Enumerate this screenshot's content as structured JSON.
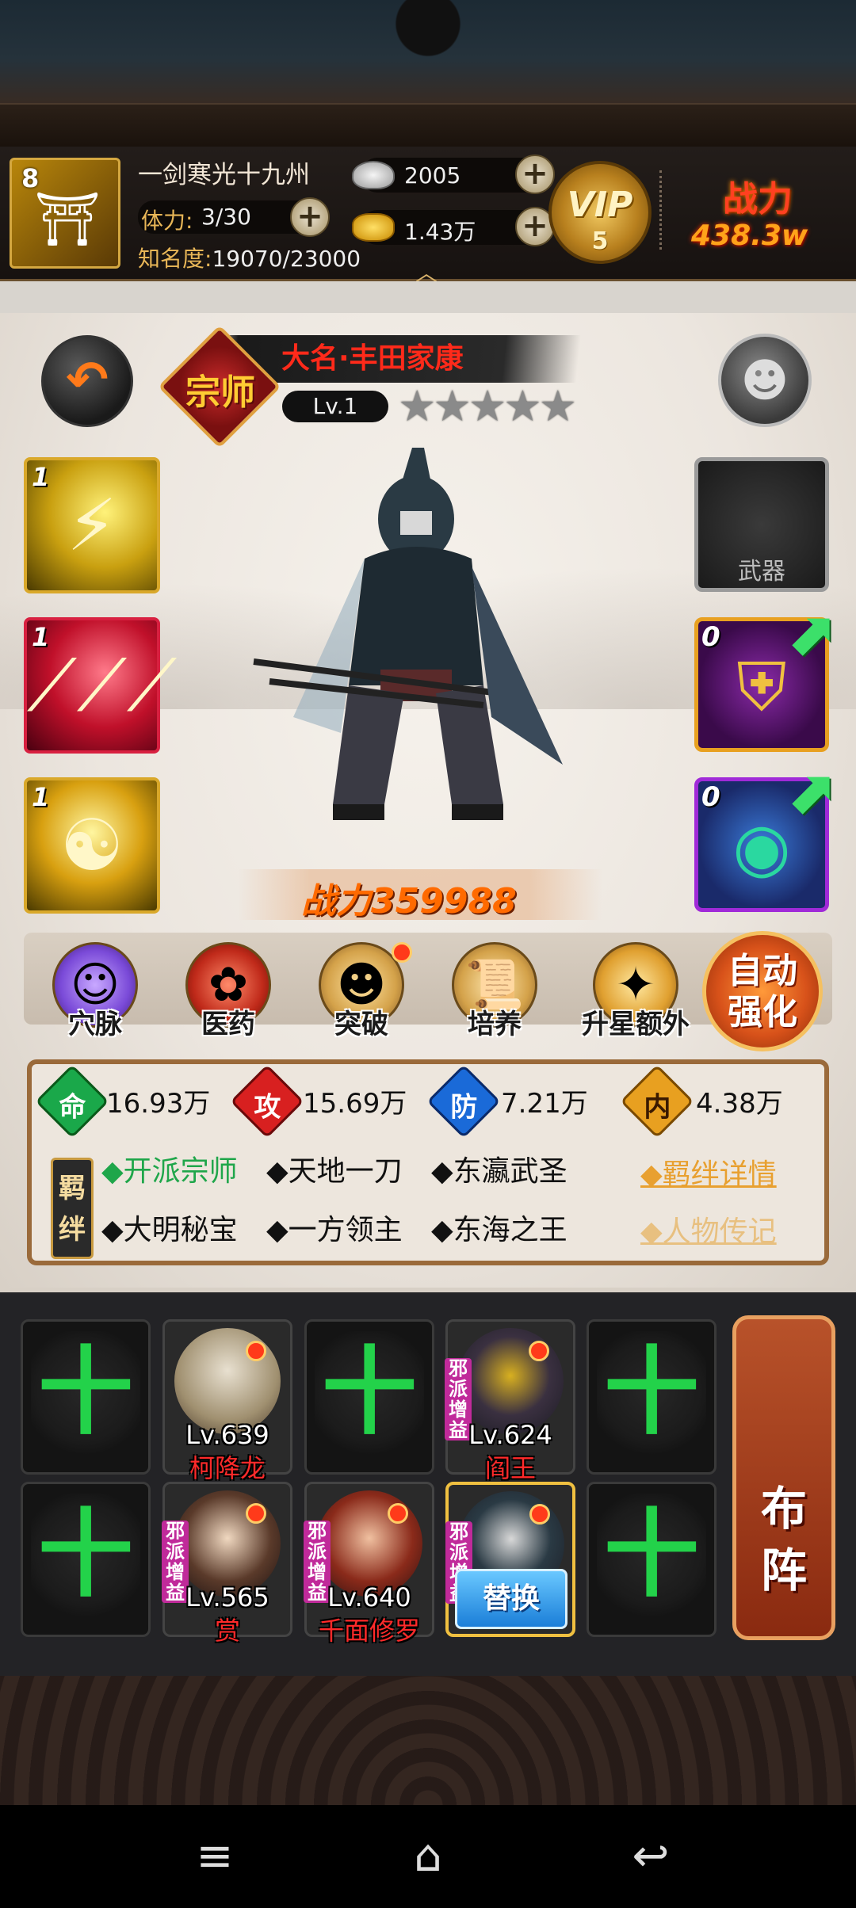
{
  "player": {
    "level": "8",
    "name": "一剑寒光十九州",
    "stamina_label": "体力:",
    "stamina_value": "3/30",
    "fame_label": "知名度:",
    "fame_value": "19070/23000",
    "silver": "2005",
    "gold": "1.43万",
    "vip_label": "VIP",
    "vip_level": "5",
    "power_label": "战力",
    "power_value": "438.3w"
  },
  "hero": {
    "rank": "宗师",
    "title": "大名·丰田家康",
    "level": "Lv.1",
    "stars": "★★★★★",
    "star_count": 0,
    "power": "战力359988"
  },
  "skills": [
    {
      "level": "1",
      "icon": "lightning-skill-icon",
      "color": "#c9a010"
    },
    {
      "level": "1",
      "icon": "claw-skill-icon",
      "color": "#c0102a"
    },
    {
      "level": "1",
      "icon": "fusion-skill-icon",
      "color": "#d8a010"
    }
  ],
  "equipment": {
    "weapon_label": "武器",
    "armor_level": "0",
    "accessory_level": "0"
  },
  "actions": [
    {
      "label": "穴脉",
      "icon": "meridian-icon"
    },
    {
      "label": "医药",
      "icon": "medicine-icon"
    },
    {
      "label": "突破",
      "icon": "breakthrough-icon"
    },
    {
      "label": "培养",
      "icon": "scroll-icon"
    },
    {
      "label": "升星额外",
      "icon": "star-up-icon"
    }
  ],
  "auto_button": "自动强化",
  "stats": [
    {
      "icon_text": "命",
      "value": "16.93万",
      "color": "#1aa84a"
    },
    {
      "icon_text": "攻",
      "value": "15.69万",
      "color": "#d82020"
    },
    {
      "icon_text": "防",
      "value": "7.21万",
      "color": "#1a6ad8"
    },
    {
      "icon_text": "内",
      "value": "4.38万",
      "color": "#e8a020"
    }
  ],
  "bond_tag": "羁绊",
  "bonds": [
    {
      "text": "◆开派宗师",
      "active": true
    },
    {
      "text": "◆天地一刀",
      "active": false
    },
    {
      "text": "◆东瀛武圣",
      "active": false
    },
    {
      "text": "◆大明秘宝",
      "active": false
    },
    {
      "text": "◆一方领主",
      "active": false
    },
    {
      "text": "◆东海之王",
      "active": false
    }
  ],
  "bond_details": "◆羁绊详情",
  "biography": "◆人物传记",
  "team": {
    "plus": "十",
    "evil_tag": "邪派增益",
    "heroes": [
      {
        "level": "Lv.639",
        "name": "柯降龙"
      },
      {
        "level": "Lv.624",
        "name": "阎王"
      },
      {
        "level": "Lv.565",
        "name": "赏"
      },
      {
        "level": "Lv.640",
        "name": "千面修罗"
      }
    ],
    "replace_label": "替换",
    "formation_label": "布阵"
  },
  "colors": {
    "accent_gold": "#d4a740",
    "power_red": "#ff4020",
    "plus_green": "#23d24a"
  }
}
